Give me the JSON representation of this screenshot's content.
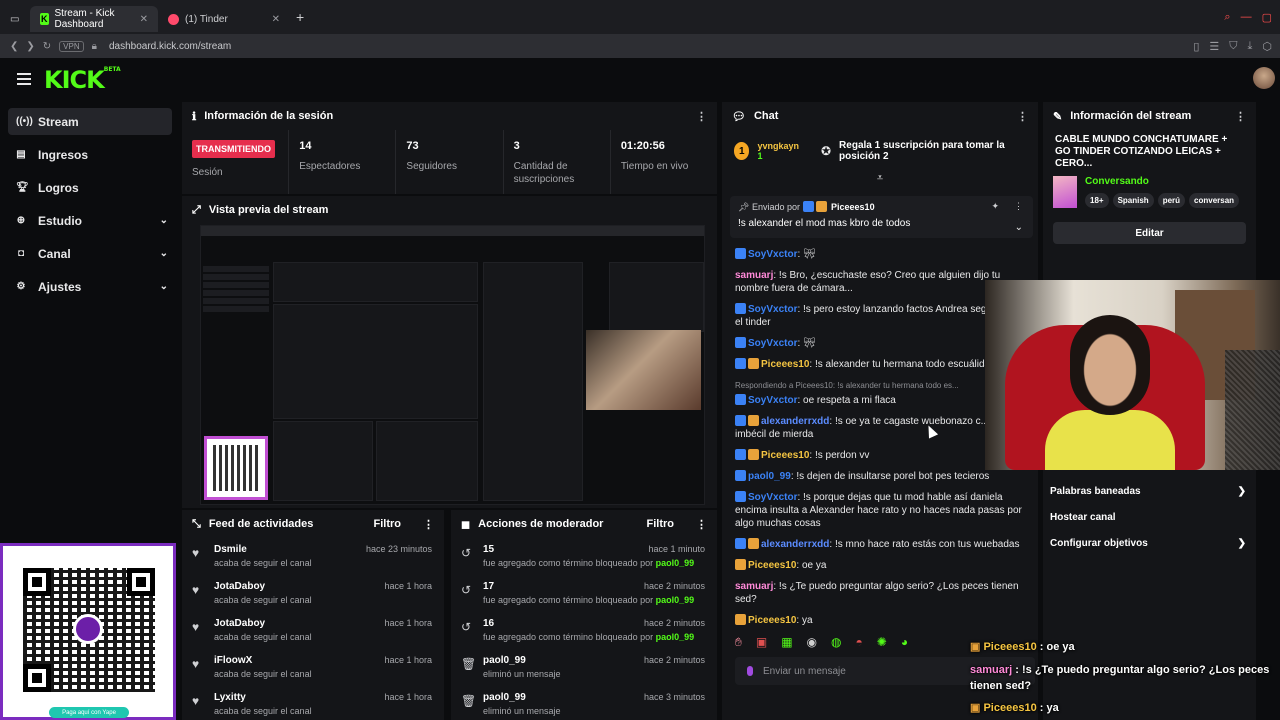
{
  "browser": {
    "tabs": [
      {
        "title": "Stream - Kick Dashboard",
        "active": true
      },
      {
        "title": "(1) Tinder",
        "active": false
      }
    ],
    "vpn_label": "VPN",
    "url": "dashboard.kick.com/stream"
  },
  "header": {
    "logo": "KICK",
    "logo_sup": "BETA"
  },
  "sidebar": {
    "items": [
      {
        "label": "Stream",
        "icon": "broadcast-icon",
        "active": true
      },
      {
        "label": "Ingresos",
        "icon": "wallet-icon"
      },
      {
        "label": "Logros",
        "icon": "trophy-icon"
      },
      {
        "label": "Estudio",
        "icon": "studio-icon",
        "expandable": true
      },
      {
        "label": "Canal",
        "icon": "channel-icon",
        "expandable": true
      },
      {
        "label": "Ajustes",
        "icon": "gear-icon",
        "expandable": true
      }
    ]
  },
  "session": {
    "title": "Información de la sesión",
    "live_badge": "TRANSMITIENDO",
    "stats": [
      {
        "value": "",
        "label": "Sesión"
      },
      {
        "value": "14",
        "label": "Espectadores"
      },
      {
        "value": "73",
        "label": "Seguidores"
      },
      {
        "value": "3",
        "label": "Cantidad de suscripciones"
      },
      {
        "value": "01:20:56",
        "label": "Tiempo en vivo"
      }
    ]
  },
  "preview": {
    "title": "Vista previa del stream"
  },
  "feed": {
    "title": "Feed de actividades",
    "filter": "Filtro",
    "items": [
      {
        "name": "Dsmile",
        "sub": "acaba de seguir el canal",
        "time": "hace 23 minutos"
      },
      {
        "name": "JotaDaboy",
        "sub": "acaba de seguir el canal",
        "time": "hace 1 hora"
      },
      {
        "name": "JotaDaboy",
        "sub": "acaba de seguir el canal",
        "time": "hace 1 hora"
      },
      {
        "name": "iFloowX",
        "sub": "acaba de seguir el canal",
        "time": "hace 1 hora"
      },
      {
        "name": "Lyxitty",
        "sub": "acaba de seguir el canal",
        "time": "hace 1 hora"
      }
    ]
  },
  "mod": {
    "title": "Acciones de moderador",
    "filter": "Filtro",
    "items": [
      {
        "name": "15",
        "sub": "fue agregado como término bloqueado por",
        "by": "paol0_99",
        "time": "hace 1 minuto",
        "icon": "undo-icon"
      },
      {
        "name": "17",
        "sub": "fue agregado como término bloqueado por",
        "by": "paol0_99",
        "time": "hace 2 minutos",
        "icon": "undo-icon"
      },
      {
        "name": "16",
        "sub": "fue agregado como término bloqueado por",
        "by": "paol0_99",
        "time": "hace 2 minutos",
        "icon": "undo-icon"
      },
      {
        "name": "paol0_99",
        "sub": "eliminó un mensaje",
        "by": "",
        "time": "hace 2 minutos",
        "icon": "trash-icon"
      },
      {
        "name": "paol0_99",
        "sub": "eliminó un mensaje",
        "by": "",
        "time": "hace 3 minutos",
        "icon": "trash-icon"
      }
    ]
  },
  "chat": {
    "title": "Chat",
    "gift_user": "yvngkayn",
    "gift_count": "1",
    "gift_msg": "Regala 1 suscripción para tomar la posición 2",
    "pinned_label": "Enviado por",
    "pinned_user": "Piceees10",
    "pinned_msg": "!s alexander el mod mas kbro de todos",
    "lines": [
      {
        "user": "SoyVxctor",
        "color": "#3b82f6",
        "badges": "b",
        "text": ""
      },
      {
        "user": "samuarj",
        "color": "#ff8ad8",
        "badges": "",
        "text": "!s Bro, ¿escuchaste eso? Creo que alguien dijo tu nombre fuera de cámara..."
      },
      {
        "user": "SoyVxctor",
        "color": "#3b82f6",
        "badges": "b",
        "text": "!s pero estoy lanzando factos Andrea según veo en el tinder"
      },
      {
        "user": "SoyVxctor",
        "color": "#3b82f6",
        "badges": "b",
        "text": ""
      },
      {
        "user": "Piceees10",
        "color": "#f5c542",
        "badges": "bo",
        "text": "!s alexander tu hermana todo escuálida"
      },
      {
        "reply": "Respondiendo a Piceees10: !s alexander tu hermana todo es...",
        "user": "SoyVxctor",
        "color": "#3b82f6",
        "badges": "b",
        "text": "oe respeta a mi flaca"
      },
      {
        "user": "alexanderrxdd",
        "color": "#5b8cff",
        "badges": "bo",
        "text": "!s oe ya te cagaste wuebonazo c... familia no imbécil de mierda"
      },
      {
        "user": "Piceees10",
        "color": "#f5c542",
        "badges": "bo",
        "text": "!s perdon vv"
      },
      {
        "user": "paol0_99",
        "color": "#3b82f6",
        "badges": "b",
        "text": "!s dejen de insultarse porel bot pes tecieros"
      },
      {
        "user": "SoyVxctor",
        "color": "#3b82f6",
        "badges": "b",
        "text": "!s porque dejas que tu mod hable así daniela encima insulta a Alexander hace rato y no haces nada pasas por algo muchas cosas"
      },
      {
        "user": "alexanderrxdd",
        "color": "#5b8cff",
        "badges": "bo",
        "text": "!s mno hace rato estás con tus wuebadas"
      },
      {
        "user": "Piceees10",
        "color": "#f5c542",
        "badges": "o",
        "text": "oe ya"
      },
      {
        "user": "samuarj",
        "color": "#ff8ad8",
        "badges": "",
        "text": "!s ¿Te puedo preguntar algo serio? ¿Los peces tienen sed?"
      },
      {
        "user": "Piceees10",
        "color": "#f5c542",
        "badges": "o",
        "text": "ya"
      }
    ],
    "input_placeholder": "Enviar un mensaje"
  },
  "stream_info": {
    "title": "Información del stream",
    "stream_title": "CABLE MUNDO CONCHATUMARE + GO TINDER COTIZANDO LEICAS + CERO...",
    "category": "Conversando",
    "tags": [
      "18+",
      "Spanish",
      "perú",
      "conversan"
    ],
    "edit": "Editar",
    "quick_links": [
      {
        "label": "Palabras baneadas",
        "chevron": true
      },
      {
        "label": "Hostear canal",
        "chevron": false
      },
      {
        "label": "Configurar objetivos",
        "chevron": true
      }
    ]
  },
  "overlay": {
    "yape_button": "Paga aquí con Yape",
    "chat": [
      {
        "user": "Piceees10",
        "text": "oe ya",
        "color": "uo"
      },
      {
        "user": "samuarj",
        "text": "!s ¿Te puedo preguntar algo serio? ¿Los peces tienen sed?",
        "color": "up"
      },
      {
        "user": "Piceees10",
        "text": "ya",
        "color": "uo"
      }
    ]
  },
  "colors": {
    "accent": "#53fc18",
    "live": "#e62e4d",
    "panel": "#141518",
    "bg": "#0b0c0e"
  }
}
